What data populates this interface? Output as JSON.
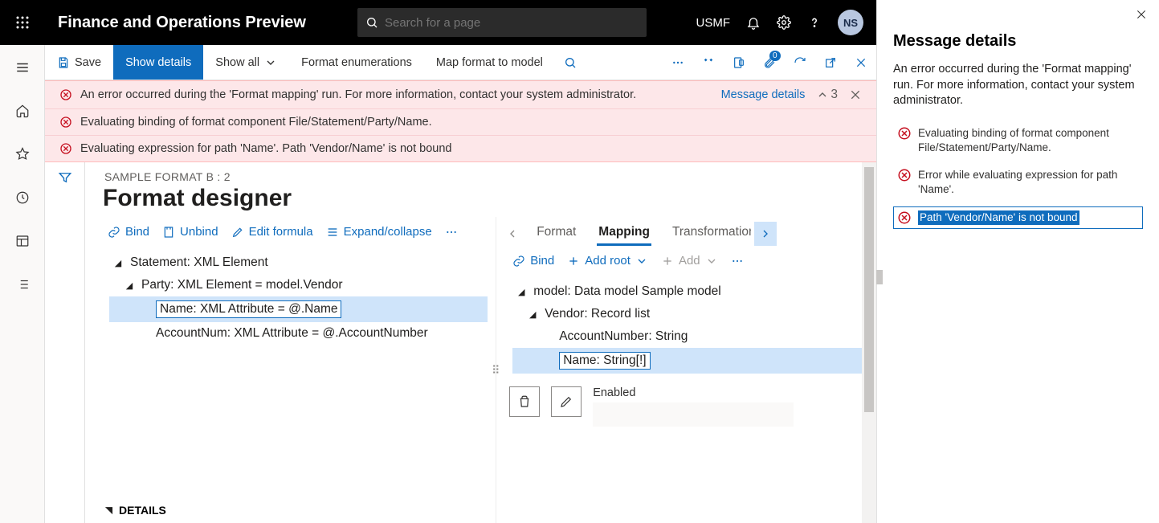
{
  "topbar": {
    "app_title": "Finance and Operations Preview",
    "search_placeholder": "Search for a page",
    "company": "USMF",
    "avatar": "NS"
  },
  "cmdbar": {
    "save": "Save",
    "show_details": "Show details",
    "show_all": "Show all",
    "format_enum": "Format enumerations",
    "map_format": "Map format to model",
    "attach_count": "0"
  },
  "banners": {
    "items": [
      "An error occurred during the 'Format mapping' run. For more information, contact your system administrator.",
      "Evaluating binding of format component File/Statement/Party/Name.",
      "Evaluating expression for path 'Name'.   Path 'Vendor/Name' is not bound"
    ],
    "details_link": "Message details",
    "collapse_count": "3"
  },
  "designer": {
    "breadcrumb": "SAMPLE FORMAT B : 2",
    "title": "Format designer",
    "left_cmds": {
      "bind": "Bind",
      "unbind": "Unbind",
      "edit": "Edit formula",
      "expand": "Expand/collapse"
    },
    "tabs": {
      "format": "Format",
      "mapping": "Mapping",
      "transform": "Transformations"
    },
    "right_cmds": {
      "bind": "Bind",
      "add_root": "Add root",
      "add": "Add"
    },
    "left_tree": {
      "n0": "Statement: XML Element",
      "n1": "Party: XML Element = model.Vendor",
      "n2": "Name: XML Attribute = @.Name",
      "n3": "AccountNum: XML Attribute = @.AccountNumber"
    },
    "right_tree": {
      "n0": "model: Data model Sample model",
      "n1": "Vendor: Record list",
      "n2": "AccountNumber: String",
      "n3": "Name: String[!]"
    },
    "enabled_label": "Enabled",
    "details_label": "DETAILS"
  },
  "msgpanel": {
    "title": "Message details",
    "intro": "An error occurred during the 'Format mapping' run. For more information, contact your system administrator.",
    "errors": [
      "Evaluating binding of format component File/Statement/Party/Name.",
      "Error while evaluating expression for path 'Name'.",
      "Path 'Vendor/Name' is not bound"
    ]
  }
}
